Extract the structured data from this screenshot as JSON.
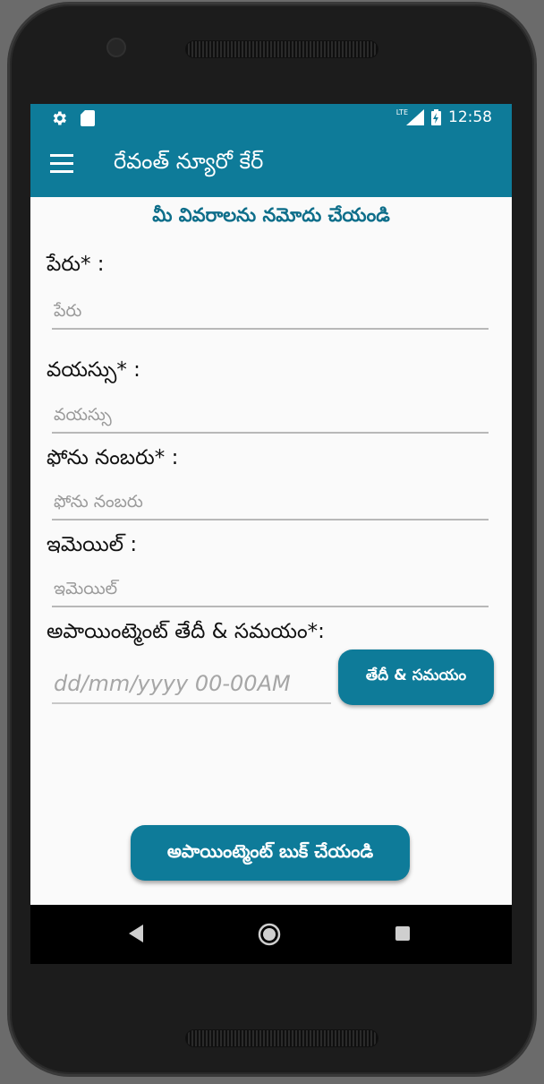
{
  "status_bar": {
    "icons_left": [
      "gear-icon",
      "sd-card-icon"
    ],
    "network": "LTE",
    "time": "12:58"
  },
  "toolbar": {
    "menu_icon": "hamburger-menu-icon",
    "title": "రేవంత్ న్యూరో కేర్"
  },
  "form": {
    "title": "మీ వివరాలను నమోదు చేయండి",
    "name": {
      "label": "పేరు* :",
      "placeholder": "పేరు",
      "value": ""
    },
    "age": {
      "label": "వయస్సు* :",
      "placeholder": "వయస్సు",
      "value": ""
    },
    "phone": {
      "label": "ఫోను నంబరు* :",
      "placeholder": "ఫోను నంబరు",
      "value": ""
    },
    "email": {
      "label": "ఇమెయిల్ :",
      "placeholder": "ఇమెయిల్",
      "value": ""
    },
    "appointment": {
      "label": "అపాయింట్మెంట్ తేదీ & సమయం*:",
      "placeholder": "dd/mm/yyyy 00-00AM",
      "value": "",
      "button_label": "తేదీ & సమయం"
    },
    "submit_label": "అపాయింట్మెంట్ బుక్ చేయండి"
  },
  "colors": {
    "primary": "#0e7b99",
    "title_text": "#0e6e8a",
    "background": "#fafafa"
  },
  "nav_bar": {
    "icons": [
      "back-icon",
      "home-icon",
      "recents-icon"
    ]
  }
}
